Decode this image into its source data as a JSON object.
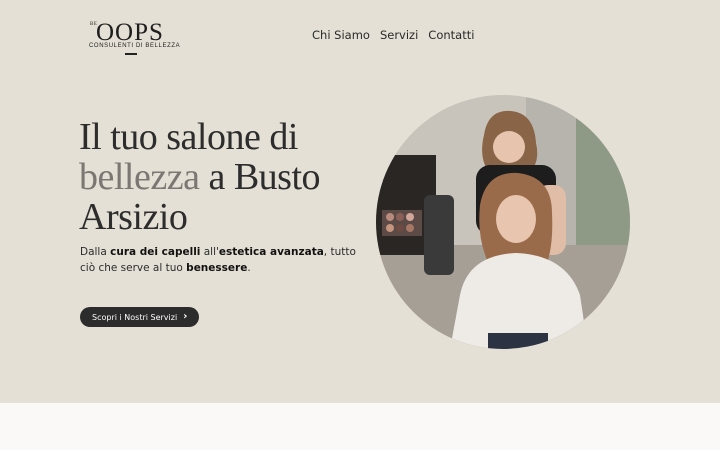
{
  "header": {
    "logo_prefix": "BE",
    "logo_name": "OOPS",
    "logo_tagline": "CONSULENTI DI BELLEZZA",
    "nav": [
      {
        "label": "Chi Siamo"
      },
      {
        "label": "Servizi"
      },
      {
        "label": "Contatti"
      }
    ]
  },
  "hero": {
    "headline_part1": "Il tuo salone di",
    "headline_highlight": "bellezza",
    "headline_part2": " a Busto",
    "headline_part3": "Arsizio",
    "desc": {
      "t1": "Dalla ",
      "b1": "cura dei capelli",
      "t2": " all'",
      "b2": "estetica avanzata",
      "t3": ", tutto ciò che serve al tuo ",
      "b3": "benessere",
      "t4": "."
    },
    "cta_label": "Scopri i Nostri Servizi",
    "cta_icon": "chevron-right-icon"
  },
  "colors": {
    "hero_bg": "#e5e0d5",
    "page_bg": "#faf9f7",
    "cta_bg": "#2c2c2c",
    "headline_muted": "#7c7772"
  }
}
